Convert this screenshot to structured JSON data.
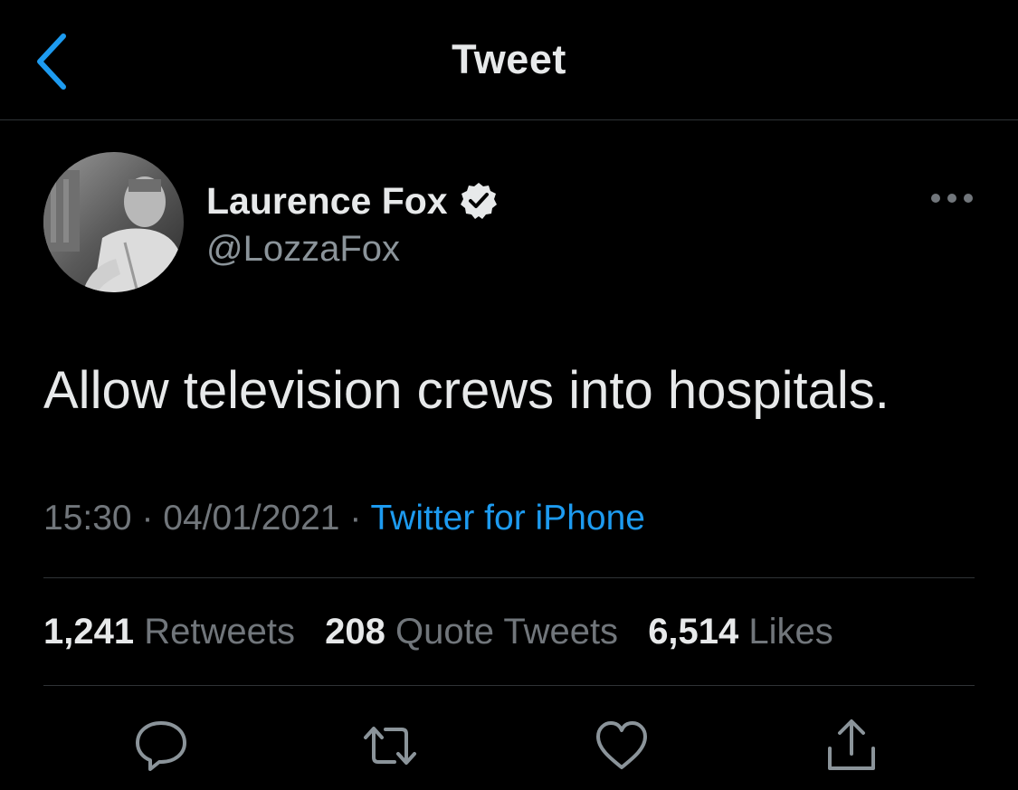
{
  "header": {
    "title": "Tweet",
    "back_icon": "chevron-left-icon"
  },
  "author": {
    "display_name": "Laurence Fox",
    "handle": "@LozzaFox",
    "verified_icon": "verified-badge-icon"
  },
  "tweet": {
    "text": "Allow television crews into hospitals.",
    "time": "15:30",
    "separator": "·",
    "date": "04/01/2021",
    "source": "Twitter for iPhone"
  },
  "stats": {
    "retweets_count": "1,241",
    "retweets_label": "Retweets",
    "quotes_count": "208",
    "quotes_label": "Quote Tweets",
    "likes_count": "6,514",
    "likes_label": "Likes"
  },
  "actions": [
    "reply-icon",
    "retweet-icon",
    "like-icon",
    "share-icon"
  ],
  "colors": {
    "background": "#000000",
    "text": "#e7e9ea",
    "secondary": "#71767b",
    "accent": "#1d9bf0",
    "divider": "#2f3336"
  }
}
